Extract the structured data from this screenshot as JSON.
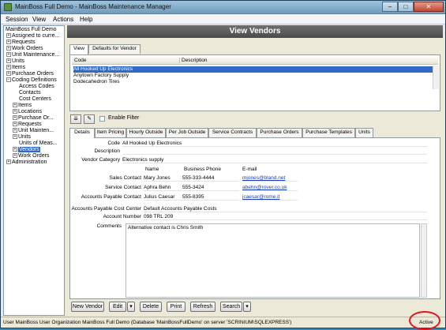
{
  "window": {
    "title": "MainBoss Full Demo - MainBoss Maintenance Manager",
    "min": "–",
    "max": "□",
    "close": "✕"
  },
  "menu": [
    "Session",
    "View",
    "Actions",
    "Help"
  ],
  "tree": [
    {
      "label": "MainBoss Full Demo",
      "exp": ""
    },
    {
      "label": "Assigned to curre...",
      "exp": "+"
    },
    {
      "label": "Requests",
      "exp": "+"
    },
    {
      "label": "Work Orders",
      "exp": "+"
    },
    {
      "label": "Unit Maintenance...",
      "exp": "+"
    },
    {
      "label": "Units",
      "exp": "+"
    },
    {
      "label": "Items",
      "exp": "+"
    },
    {
      "label": "Purchase Orders",
      "exp": "+"
    },
    {
      "label": "Coding Definitions",
      "exp": "−"
    },
    {
      "label": "Access Codes",
      "exp": ""
    },
    {
      "label": "Contacts",
      "exp": ""
    },
    {
      "label": "Cost Centers",
      "exp": ""
    },
    {
      "label": "Items",
      "exp": "+"
    },
    {
      "label": "Locations",
      "exp": "+"
    },
    {
      "label": "Purchase Or...",
      "exp": "+"
    },
    {
      "label": "Requests",
      "exp": "+"
    },
    {
      "label": "Unit Mainten...",
      "exp": "+"
    },
    {
      "label": "Units",
      "exp": "+"
    },
    {
      "label": "Units of Meas...",
      "exp": ""
    },
    {
      "label": "Vendors",
      "exp": "+"
    },
    {
      "label": "Work Orders",
      "exp": "+"
    },
    {
      "label": "Administration",
      "exp": "+"
    }
  ],
  "header": "View Vendors",
  "view_tabs": [
    "View",
    "Defaults for Vendor"
  ],
  "list": {
    "columns": [
      "Code",
      "Description"
    ],
    "rows": [
      "All Hooked Up Electronics",
      "Anytown Factory Supply",
      "Dodecahedron Tires"
    ]
  },
  "filter_label": "Enable Filter",
  "detail_tabs": [
    "Details",
    "Item Pricing",
    "Hourly Outside",
    "Per Job Outside",
    "Service Contracts",
    "Purchase Orders",
    "Purchase Templates",
    "Units"
  ],
  "details": {
    "code_label": "Code",
    "code": "All Hooked Up Electronics",
    "description_label": "Description",
    "description": "",
    "category_label": "Vendor Category",
    "category": "Electronics supply",
    "col_name": "Name",
    "col_phone": "Business Phone",
    "col_email": "E-mail",
    "sales_label": "Sales Contact",
    "sales_name": "Mary Jones",
    "sales_phone": "555-333-4444",
    "sales_email": "mjones@bland.net",
    "service_label": "Service Contact",
    "service_name": "Aphra Behn",
    "service_phone": "555-3424",
    "service_email": "abehn@rover.co.uk",
    "ap_label": "Accounts Payable Contact",
    "ap_name": "Julius Caesar",
    "ap_phone": "555-8395",
    "ap_email": "jcaesar@rome.it",
    "ap_cc_label": "Accounts Payable Cost Center",
    "ap_cc": "Default Accounts Payable Costs",
    "acct_label": "Account Number",
    "acct": "098 TRL 209",
    "comments_label": "Comments",
    "comments": "Alternative contact is Chris Smith"
  },
  "buttons": {
    "new": "New Vendor",
    "edit": "Edit",
    "delete": "Delete",
    "print": "Print",
    "refresh": "Refresh",
    "search": "Search",
    "dd": "▾"
  },
  "status": {
    "text": "User MainBoss User Organization MainBoss Full Demo (Database 'MainBossFullDemo' on server 'SCRINIUM\\SQLEXPRESS')",
    "state": "Active"
  }
}
